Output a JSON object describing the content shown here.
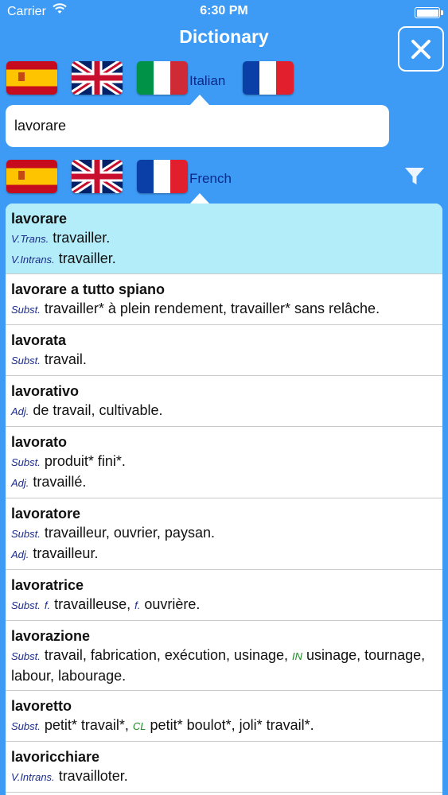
{
  "status_bar": {
    "carrier": "Carrier",
    "time": "6:30 PM"
  },
  "nav": {
    "title": "Dictionary",
    "close_icon": "close-icon"
  },
  "source_languages": {
    "flags": [
      "spain",
      "uk",
      "italy",
      "france"
    ],
    "selected": "italy",
    "selected_label": "Italian"
  },
  "search": {
    "value": "lavorare"
  },
  "target_languages": {
    "flags": [
      "spain",
      "uk",
      "france"
    ],
    "selected": "france",
    "selected_label": "French",
    "filter_icon": "filter-icon"
  },
  "colors": {
    "background": "#3d9bf5",
    "selected_row": "#b3edfa",
    "pos_label": "#1a2a8a",
    "register_tag": "#1f8a25"
  },
  "entries": [
    {
      "headword": "lavorare",
      "selected": true,
      "senses": [
        {
          "pos": "V.Trans.",
          "parts": [
            {
              "text": "travailler."
            }
          ]
        },
        {
          "pos": "V.Intrans.",
          "parts": [
            {
              "text": "travailler."
            }
          ]
        }
      ]
    },
    {
      "headword": "lavorare a tutto spiano",
      "senses": [
        {
          "pos": "Subst.",
          "parts": [
            {
              "text": "travailler* à plein rendement, travailler* sans relâche."
            }
          ]
        }
      ]
    },
    {
      "headword": "lavorata",
      "senses": [
        {
          "pos": "Subst.",
          "parts": [
            {
              "text": "travail."
            }
          ]
        }
      ]
    },
    {
      "headword": "lavorativo",
      "senses": [
        {
          "pos": "Adj.",
          "parts": [
            {
              "text": "de travail, cultivable."
            }
          ]
        }
      ]
    },
    {
      "headword": "lavorato",
      "senses": [
        {
          "pos": "Subst.",
          "parts": [
            {
              "text": "produit* fini*."
            }
          ]
        },
        {
          "pos": "Adj.",
          "parts": [
            {
              "text": "travaillé."
            }
          ]
        }
      ]
    },
    {
      "headword": "lavoratore",
      "senses": [
        {
          "pos": "Subst.",
          "parts": [
            {
              "text": "travailleur, ouvrier, paysan."
            }
          ]
        },
        {
          "pos": "Adj.",
          "parts": [
            {
              "text": "travailleur."
            }
          ]
        }
      ]
    },
    {
      "headword": "lavoratrice",
      "senses": [
        {
          "pos": "Subst.",
          "parts": [
            {
              "pos": "f.",
              "text": "travailleuse, "
            },
            {
              "pos": "f.",
              "text": "ouvrière."
            }
          ]
        }
      ]
    },
    {
      "headword": "lavorazione",
      "senses": [
        {
          "pos": "Subst.",
          "parts": [
            {
              "text": "travail, fabrication, exécution, usinage, "
            },
            {
              "tag": "IN",
              "text": "usinage, tournage, labour, labourage."
            }
          ]
        }
      ]
    },
    {
      "headword": "lavoretto",
      "senses": [
        {
          "pos": "Subst.",
          "parts": [
            {
              "text": "petit* travail*, "
            },
            {
              "tag": "CL",
              "text": "petit* boulot*, joli* travail*."
            }
          ]
        }
      ]
    },
    {
      "headword": "lavoricchiare",
      "senses": [
        {
          "pos": "V.Intrans.",
          "parts": [
            {
              "text": "travailloter."
            }
          ]
        }
      ]
    }
  ]
}
